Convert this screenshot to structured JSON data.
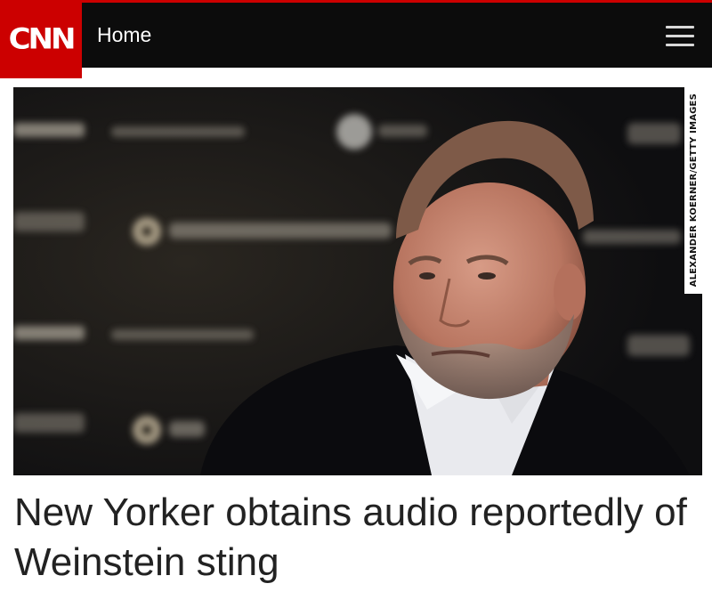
{
  "header": {
    "logo_text": "CNN",
    "nav_label": "Home",
    "menu_icon": "hamburger-menu-icon"
  },
  "colors": {
    "brand_red": "#cc0000",
    "header_bg": "#0c0c0c",
    "headline_text": "#222222"
  },
  "article": {
    "image_credit": "ALEXANDER KOERNER/GETTY IMAGES",
    "headline": "New Yorker obtains audio reportedly of Weinstein sting"
  }
}
